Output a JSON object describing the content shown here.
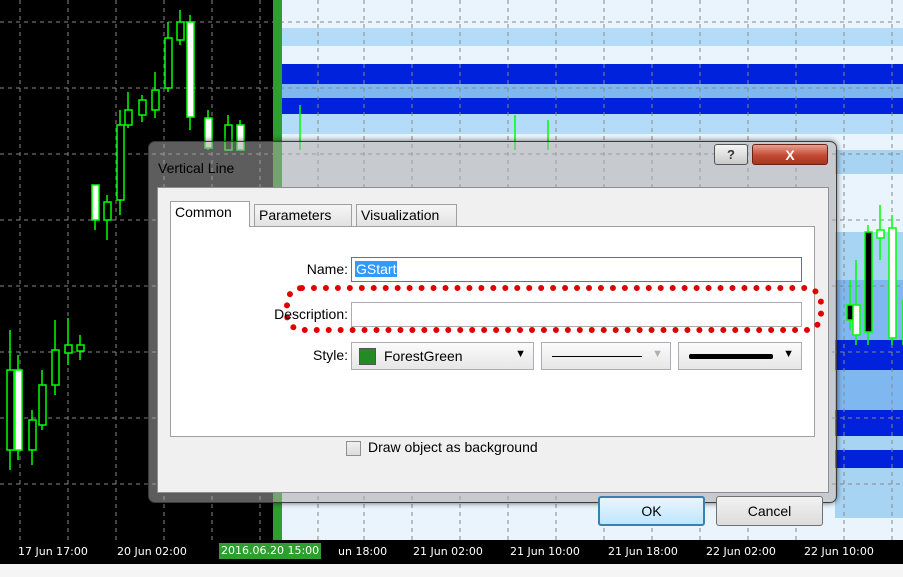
{
  "dialog": {
    "title": "Vertical Line",
    "help_glyph": "?",
    "close_glyph": "X",
    "tabs": [
      {
        "label": "Common",
        "active": true
      },
      {
        "label": "Parameters",
        "active": false
      },
      {
        "label": "Visualization",
        "active": false
      }
    ],
    "fields": {
      "name_label": "Name:",
      "name_value": "GStart",
      "description_label": "Description:",
      "description_value": "",
      "style_label": "Style:",
      "color_name": "ForestGreen",
      "color_hex": "#228b22",
      "line_style": "solid",
      "line_width": "thick"
    },
    "background_checkbox": {
      "label": "Draw object as background",
      "checked": false
    },
    "buttons": {
      "ok": "OK",
      "cancel": "Cancel"
    }
  },
  "time_axis": {
    "labels": [
      {
        "text": "17 Jun 17:00",
        "highlight": false
      },
      {
        "text": "20 Jun 02:00",
        "highlight": false
      },
      {
        "text": "2016.06.20 15:00",
        "highlight": true
      },
      {
        "text": "un 18:00",
        "highlight": false
      },
      {
        "text": "21 Jun 02:00",
        "highlight": false
      },
      {
        "text": "21 Jun 10:00",
        "highlight": false
      },
      {
        "text": "21 Jun 18:00",
        "highlight": false
      },
      {
        "text": "22 Jun 02:00",
        "highlight": false
      },
      {
        "text": "22 Jun 10:00",
        "highlight": false
      }
    ]
  },
  "colors": {
    "chart_background": "#000000",
    "candle_color": "#00ff00",
    "marker_line": "#2f9d2f",
    "band_dark_blue": "#0022dd",
    "band_light_blue": "#a8d4f4"
  }
}
